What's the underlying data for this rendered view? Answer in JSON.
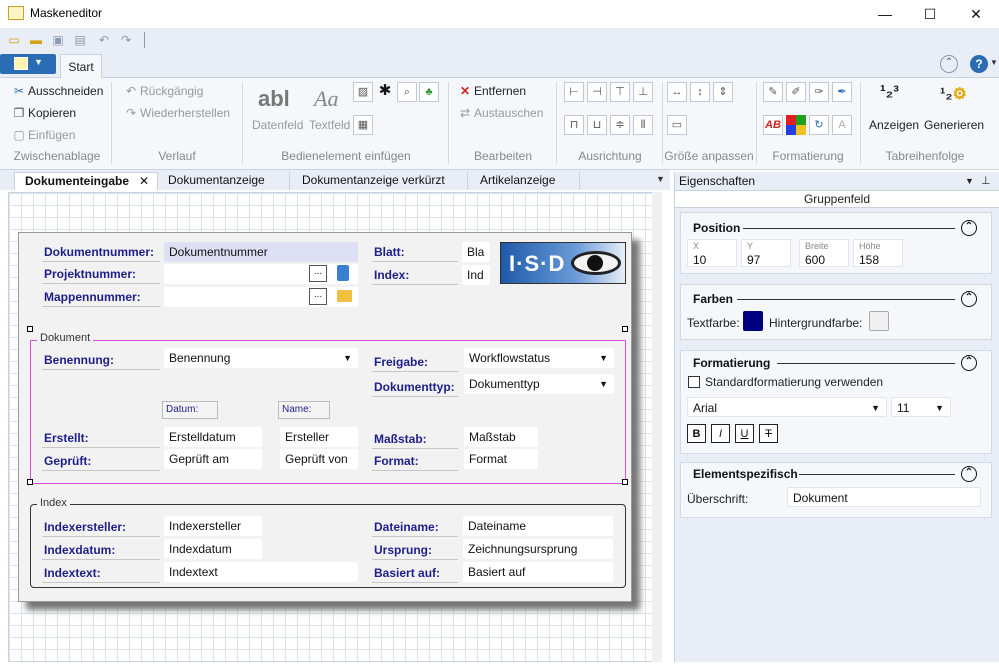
{
  "window": {
    "title": "Maskeneditor",
    "minimize": "—",
    "maximize": "☐",
    "close": "✕"
  },
  "ribbon": {
    "tab_start": "Start",
    "groups": {
      "zwischenablage": {
        "label": "Zwischenablage",
        "ausschneiden": "Ausschneiden",
        "kopieren": "Kopieren",
        "einfuegen": "Einfügen"
      },
      "verlauf": {
        "label": "Verlauf",
        "rueckgaengig": "Rückgängig",
        "wiederherstellen": "Wiederherstellen"
      },
      "bedienelement": {
        "label": "Bedienelement einfügen",
        "datenfeld": "Datenfeld",
        "textfeld": "Textfeld",
        "datenfeld_glyph": "abl",
        "textfeld_glyph": "Aa"
      },
      "bearbeiten": {
        "label": "Bearbeiten",
        "entfernen": "Entfernen",
        "austauschen": "Austauschen"
      },
      "ausrichtung": {
        "label": "Ausrichtung"
      },
      "groesse": {
        "label": "Größe anpassen"
      },
      "formatierung": {
        "label": "Formatierung",
        "ab_glyph": "AB"
      },
      "tabreihenfolge": {
        "label": "Tabreihenfolge",
        "anzeigen": "Anzeigen",
        "generieren": "Generieren"
      }
    }
  },
  "doc_tabs": [
    {
      "label": "Dokumenteingabe",
      "active": true
    },
    {
      "label": "Dokumentanzeige"
    },
    {
      "label": "Dokumentanzeige verkürzt"
    },
    {
      "label": "Artikelanzeige"
    }
  ],
  "form": {
    "dokumentnummer_label": "Dokumentnummer:",
    "dokumentnummer_value": "Dokumentnummer",
    "projektnummer_label": "Projektnummer:",
    "mappennummer_label": "Mappennummer:",
    "blatt_label": "Blatt:",
    "blatt_value": "Bla",
    "index_label": "Index:",
    "index_value": "Ind",
    "browse": "...",
    "logo_text": "I·S·D",
    "group_dokument": "Dokument",
    "benennung_label": "Benennung:",
    "benennung_value": "Benennung",
    "freigabe_label": "Freigabe:",
    "freigabe_value": "Workflowstatus",
    "dokumenttyp_label": "Dokumenttyp:",
    "dokumenttyp_value": "Dokumenttyp",
    "datum_label": "Datum:",
    "name_label": "Name:",
    "erstellt_label": "Erstellt:",
    "erstelldatum": "Erstelldatum",
    "ersteller": "Ersteller",
    "massstab_label": "Maßstab:",
    "massstab_value": "Maßstab",
    "geprueft_label": "Geprüft:",
    "geprueft_am": "Geprüft am",
    "geprueft_von": "Geprüft von",
    "format_label": "Format:",
    "format_value": "Format",
    "group_index": "Index",
    "indexersteller_label": "Indexersteller:",
    "indexersteller_value": "Indexersteller",
    "indexdatum_label": "Indexdatum:",
    "indexdatum_value": "Indexdatum",
    "indextext_label": "Indextext:",
    "indextext_value": "Indextext",
    "dateiname_label": "Dateiname:",
    "dateiname_value": "Dateiname",
    "ursprung_label": "Ursprung:",
    "ursprung_value": "Zeichnungsursprung",
    "basiert_label": "Basiert auf:",
    "basiert_value": "Basiert auf"
  },
  "properties": {
    "title": "Eigenschaften",
    "subtitle": "Gruppenfeld",
    "position": {
      "label": "Position",
      "x_label": "X",
      "x": "10",
      "y_label": "Y",
      "y": "97",
      "breite_label": "Breite",
      "breite": "600",
      "hoehe_label": "Höhe",
      "hoehe": "158"
    },
    "farben": {
      "label": "Farben",
      "textfarbe": "Textfarbe:",
      "hintergrundfarbe": "Hintergrundfarbe:",
      "text_color": "#000080"
    },
    "formatierung": {
      "label": "Formatierung",
      "standard": "Standardformatierung verwenden",
      "font": "Arial",
      "size": "11",
      "bold": "B",
      "italic": "I",
      "underline": "U",
      "strike": "T"
    },
    "element": {
      "label": "Elementspezifisch",
      "ueberschrift_label": "Überschrift:",
      "ueberschrift": "Dokument"
    }
  }
}
